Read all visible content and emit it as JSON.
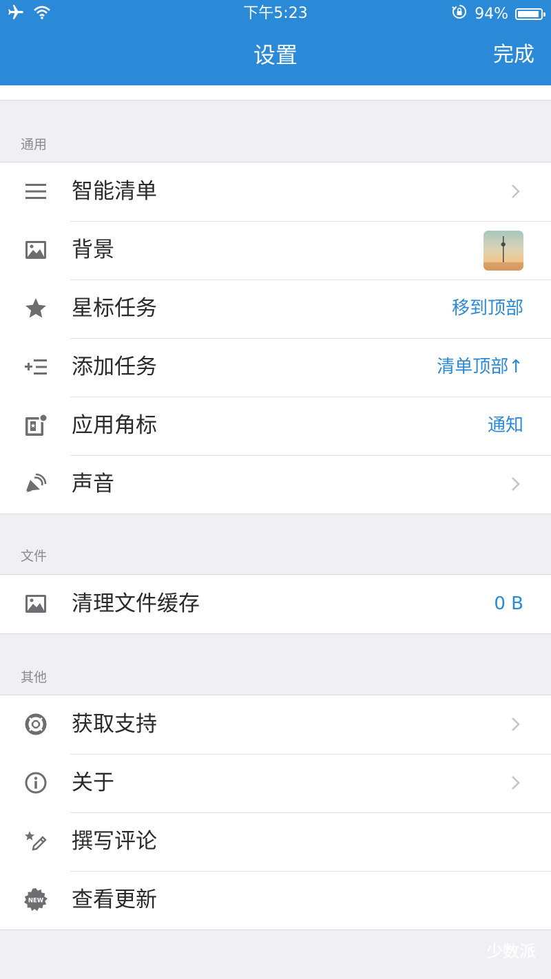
{
  "status_bar": {
    "time": "下午5:23",
    "battery": "94%",
    "battery_level": 0.94
  },
  "nav": {
    "title": "设置",
    "done": "完成"
  },
  "sections": [
    {
      "label": "通用",
      "items": [
        {
          "label": "智能清单",
          "icon": "list-icon",
          "accessory": "chevron"
        },
        {
          "label": "背景",
          "icon": "image-icon",
          "accessory": "thumbnail"
        },
        {
          "label": "星标任务",
          "icon": "star-icon",
          "value": "移到顶部"
        },
        {
          "label": "添加任务",
          "icon": "add-task-icon",
          "value": "清单顶部↑"
        },
        {
          "label": "应用角标",
          "icon": "badge-icon",
          "value": "通知"
        },
        {
          "label": "声音",
          "icon": "speaker-icon",
          "accessory": "chevron"
        }
      ]
    },
    {
      "label": "文件",
      "items": [
        {
          "label": "清理文件缓存",
          "icon": "image-icon",
          "value": "0 B"
        }
      ]
    },
    {
      "label": "其他",
      "items": [
        {
          "label": "获取支持",
          "icon": "lifebuoy-icon",
          "accessory": "chevron"
        },
        {
          "label": "关于",
          "icon": "info-icon",
          "accessory": "chevron"
        },
        {
          "label": "撰写评论",
          "icon": "review-icon"
        },
        {
          "label": "查看更新",
          "icon": "new-badge-icon",
          "icon_text": "NEW"
        }
      ]
    }
  ],
  "watermark": "少数派"
}
